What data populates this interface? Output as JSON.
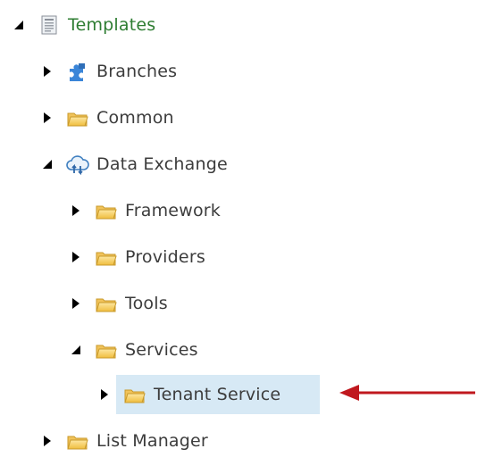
{
  "tree": {
    "items": [
      {
        "label": "Templates",
        "expanded": true,
        "icon": "template-page-icon"
      },
      {
        "label": "Branches",
        "expanded": false,
        "icon": "puzzle-icon"
      },
      {
        "label": "Common",
        "expanded": false,
        "icon": "folder-icon"
      },
      {
        "label": "Data Exchange",
        "expanded": true,
        "icon": "cloud-exchange-icon"
      },
      {
        "label": "Framework",
        "expanded": false,
        "icon": "folder-icon"
      },
      {
        "label": "Providers",
        "expanded": false,
        "icon": "folder-icon"
      },
      {
        "label": "Tools",
        "expanded": false,
        "icon": "folder-icon"
      },
      {
        "label": "Services",
        "expanded": true,
        "icon": "folder-icon"
      },
      {
        "label": "Tenant Service",
        "expanded": false,
        "icon": "folder-icon",
        "selected": true
      },
      {
        "label": "List Manager",
        "expanded": false,
        "icon": "folder-icon"
      }
    ]
  },
  "colors": {
    "root_label": "#2e7d32",
    "label": "#3c3c3c",
    "selection": "#d7e9f5",
    "pointer_arrow": "#c0181e",
    "folder": "#f4cc5a"
  }
}
